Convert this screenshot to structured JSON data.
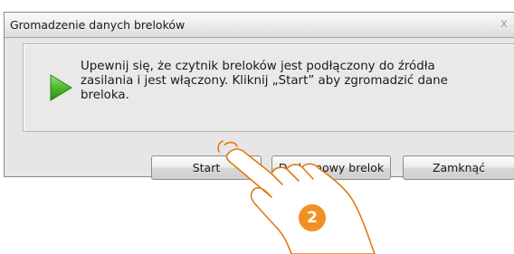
{
  "dialog": {
    "title": "Gromadzenie danych breloków",
    "close_glyph": "x",
    "message": "Upewnij się, że czytnik breloków jest podłączony do źródła zasilania i jest włączony. Kliknij „Start” aby zgromadzić dane breloka.",
    "icon": "green-play-arrow-icon",
    "buttons": {
      "start": "Start",
      "add_new": "Dodaj nowy brelok",
      "close": "Zamknąć"
    }
  },
  "overlay": {
    "hand_icon": "pointing-hand-icon",
    "step_number": "2",
    "step_color": "#f39023"
  }
}
